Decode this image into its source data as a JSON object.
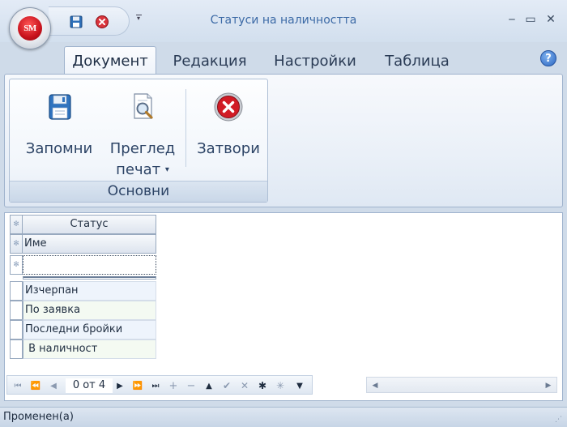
{
  "window": {
    "title": "Статуси на наличността",
    "app_logo": "SM",
    "minimize_glyph": "‒",
    "maximize_glyph": "▭",
    "close_glyph": "✕"
  },
  "quick_access": {
    "items": [
      "save-icon",
      "close-circle-icon"
    ],
    "dropdown_glyph": "▾"
  },
  "tabs": [
    {
      "label": "Документ",
      "active": true
    },
    {
      "label": "Редакция",
      "active": false
    },
    {
      "label": "Настройки",
      "active": false
    },
    {
      "label": "Таблица",
      "active": false
    }
  ],
  "help": {
    "glyph": "?"
  },
  "ribbon": {
    "group_label": "Основни",
    "buttons": {
      "save": {
        "label": "Запомни",
        "icon": "floppy-disk-icon"
      },
      "preview": {
        "label_line1": "Преглед",
        "label_line2": "печат",
        "dropdown_glyph": "▾",
        "icon": "print-preview-icon"
      },
      "close": {
        "label": "Затвори",
        "icon": "close-circle-icon"
      }
    }
  },
  "grid": {
    "band_header": "Статус",
    "column_header": "Име",
    "indicator_glyph": "✻",
    "new_row_value": "",
    "rows": [
      "Изчерпан",
      "По заявка",
      "Последни бройки",
      " В наличност"
    ]
  },
  "navigator": {
    "record_text": "0 от 4",
    "buttons": [
      "first",
      "prev-page",
      "prev",
      "next",
      "next-page",
      "last",
      "append",
      "delete",
      "edit",
      "post",
      "cancel",
      "refresh",
      "save-bookmark",
      "filter"
    ]
  },
  "status": {
    "text": "Променен(а)"
  },
  "colors": {
    "accent": "#3c6aa6",
    "close_red": "#d0121e",
    "frame_blue": "#cfdbe9"
  }
}
